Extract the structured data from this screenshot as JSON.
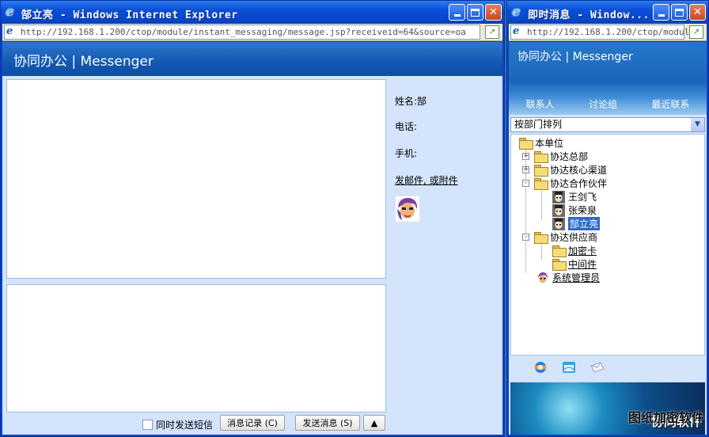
{
  "left_window": {
    "title": "郜立亮 - Windows Internet Explorer",
    "url": "http://192.168.1.200/ctop/module/instant_messaging/message.jsp?receiveid=64&source=oa",
    "brand": "协同办公 | Messenger",
    "contact_info": {
      "name_label": "姓名:郜",
      "phone_label": "电话:",
      "mobile_label": "手机:",
      "mail_link": "发邮件, 或附件"
    },
    "bottom_bar": {
      "sms_label": "同时发送短信",
      "sms_checked": false,
      "history_button": "消息记录 (C)",
      "send_button": "发送消息 (S)",
      "up_button": "▲"
    }
  },
  "right_window": {
    "title": "即时消息 - Window...",
    "url": "http://192.168.1.200/ctop/module",
    "brand": "协同办公 | Messenger",
    "tabs": [
      "联系人",
      "讨论组",
      "最近联系"
    ],
    "sort_select": "按部门排列",
    "tree": [
      {
        "label": "本单位",
        "type": "folder-open",
        "level": 0
      },
      {
        "label": "协达总部",
        "type": "folder",
        "level": 1,
        "expander": "+"
      },
      {
        "label": "协达核心渠道",
        "type": "folder",
        "level": 1,
        "expander": "+"
      },
      {
        "label": "协达合作伙伴",
        "type": "folder-open",
        "level": 1,
        "expander": "-"
      },
      {
        "label": "王剑飞",
        "type": "person",
        "level": 2
      },
      {
        "label": "张荣泉",
        "type": "person",
        "level": 2
      },
      {
        "label": "郜立亮",
        "type": "person",
        "level": 2,
        "selected": true
      },
      {
        "label": "协达供应商",
        "type": "folder-open",
        "level": 1,
        "expander": "-"
      },
      {
        "label": "加密卡",
        "type": "folder",
        "level": 2,
        "underline": true
      },
      {
        "label": "中间件",
        "type": "folder",
        "level": 2,
        "underline": true
      },
      {
        "label": "系统管理员",
        "type": "person",
        "level": 1,
        "underline": true
      }
    ],
    "tool_icons": [
      "contacts-icon",
      "window-icon",
      "mail-icon"
    ],
    "ad_text": "协同软件"
  },
  "watermark": "图纸加密软件"
}
